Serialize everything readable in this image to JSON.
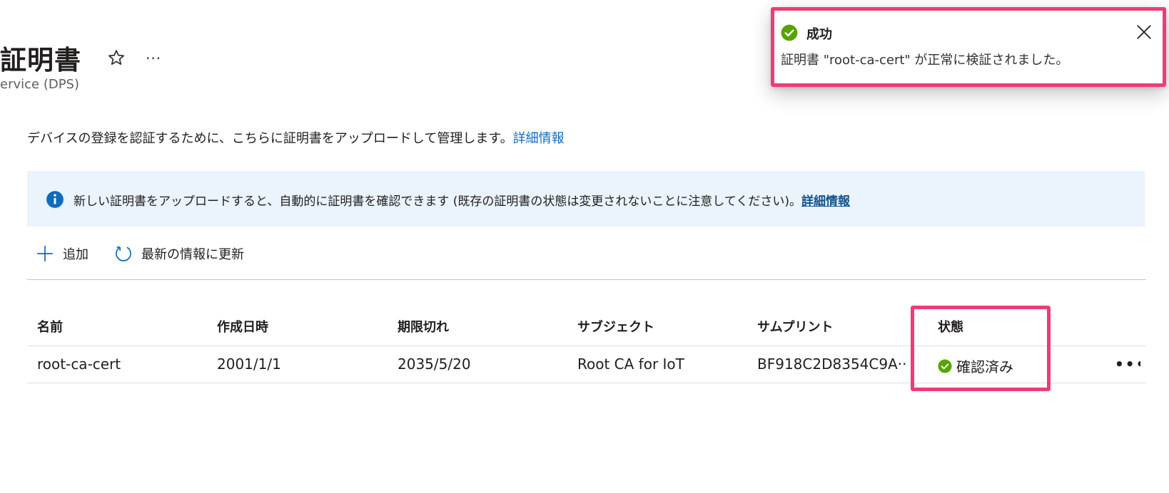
{
  "header": {
    "title": "証明書",
    "subtitle": "ervice (DPS)",
    "more_label": "···"
  },
  "description": {
    "text": "デバイスの登録を認証するために、こちらに証明書をアップロードして管理します。",
    "link": "詳細情報"
  },
  "info_banner": {
    "text": "新しい証明書をアップロードすると、自動的に証明書を確認できます (既存の証明書の状態は変更されないことに注意してください)。",
    "link": "詳細情報"
  },
  "toolbar": {
    "add_label": "追加",
    "refresh_label": "最新の情報に更新"
  },
  "table": {
    "columns": [
      "名前",
      "作成日時",
      "期限切れ",
      "サブジェクト",
      "サムプリント",
      "状態"
    ],
    "rows": [
      {
        "name": "root-ca-cert",
        "created": "2001/1/1",
        "expiry": "2035/5/20",
        "subject": "Root CA for IoT",
        "thumbprint": "BF918C2D8354C9A··",
        "status": "確認済み",
        "more": "•••"
      }
    ]
  },
  "toast": {
    "title": "成功",
    "message": "証明書 \"root-ca-cert\" が正常に検証されました。"
  },
  "colors": {
    "link": "#0f6cbd",
    "success": "#57a300",
    "info": "#0f6cbd",
    "highlight": "#ee3c78",
    "banner_bg": "#ebf3fc"
  },
  "icons": {
    "star": "star-icon",
    "info": "info-icon",
    "add": "plus-icon",
    "refresh": "refresh-icon",
    "success": "check-circle-icon",
    "close": "close-icon"
  }
}
